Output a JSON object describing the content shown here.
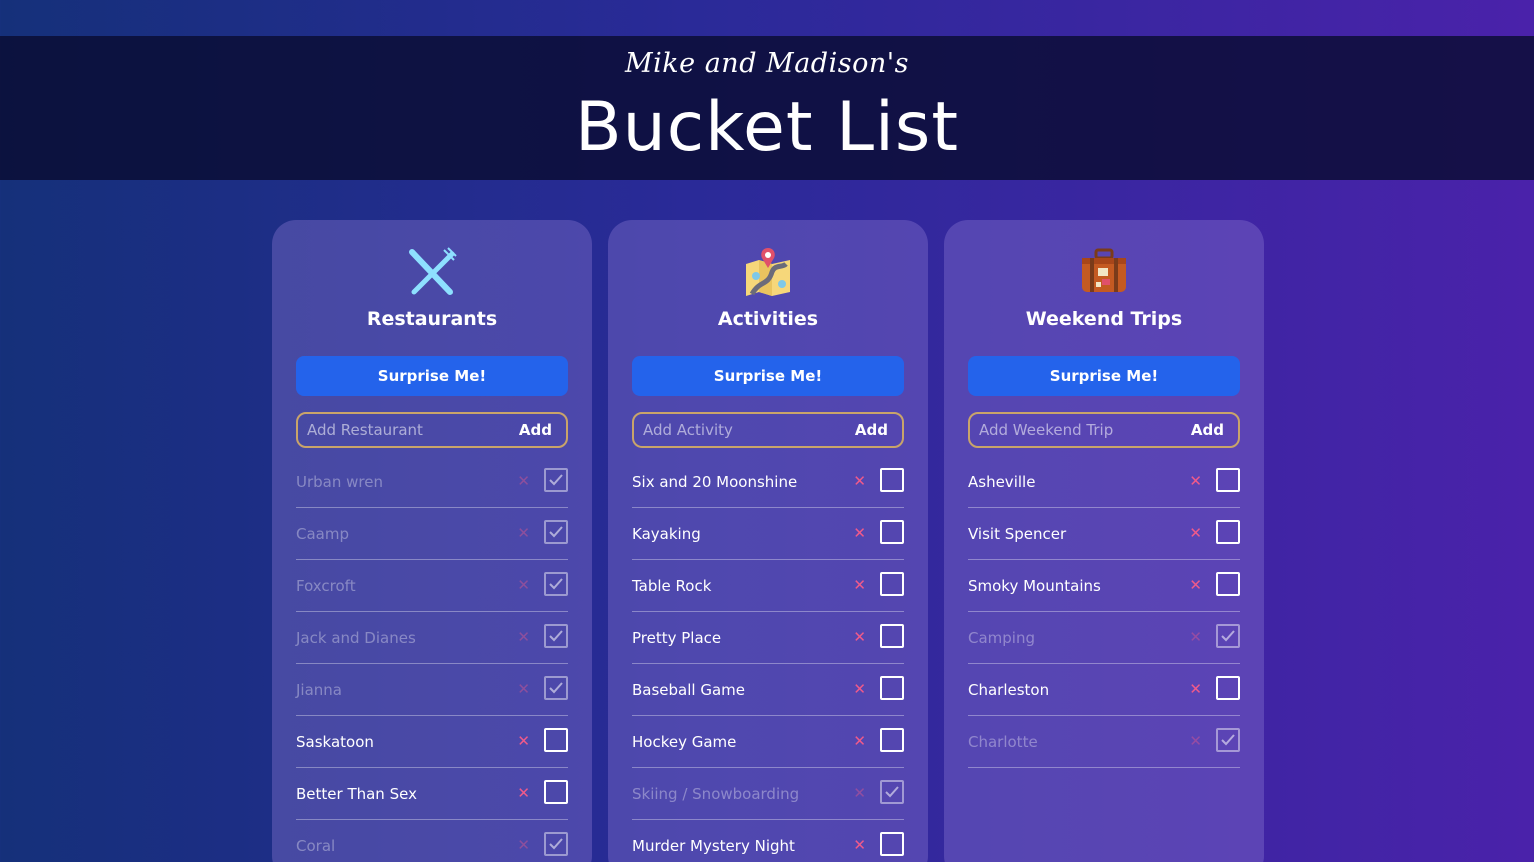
{
  "header": {
    "script_title": "Mike and Madison's",
    "title": "Bucket List"
  },
  "colors": {
    "accent": "#2463eb",
    "input_border": "#c9a46a",
    "delete": "#f05a8a"
  },
  "restaurants": {
    "icon": "fork-knife-icon",
    "title": "Restaurants",
    "surprise_label": "Surprise Me!",
    "add_placeholder": "Add Restaurant",
    "add_label": "Add",
    "items": [
      {
        "label": "Urban wren",
        "done": true
      },
      {
        "label": "Caamp",
        "done": true
      },
      {
        "label": "Foxcroft",
        "done": true
      },
      {
        "label": "Jack and Dianes",
        "done": true
      },
      {
        "label": "Jianna",
        "done": true
      },
      {
        "label": "Saskatoon",
        "done": false
      },
      {
        "label": "Better Than Sex",
        "done": false
      },
      {
        "label": "Coral",
        "done": true
      }
    ]
  },
  "activities": {
    "icon": "map-pin-icon",
    "title": "Activities",
    "surprise_label": "Surprise Me!",
    "add_placeholder": "Add Activity",
    "add_label": "Add",
    "items": [
      {
        "label": "Six and 20 Moonshine",
        "done": false
      },
      {
        "label": "Kayaking",
        "done": false
      },
      {
        "label": "Table Rock",
        "done": false
      },
      {
        "label": "Pretty Place",
        "done": false
      },
      {
        "label": "Baseball Game",
        "done": false
      },
      {
        "label": "Hockey Game",
        "done": false
      },
      {
        "label": "Skiing / Snowboarding",
        "done": true
      },
      {
        "label": "Murder Mystery Night",
        "done": false
      }
    ]
  },
  "weekend": {
    "icon": "suitcase-icon",
    "title": "Weekend Trips",
    "surprise_label": "Surprise Me!",
    "add_placeholder": "Add Weekend Trip",
    "add_label": "Add",
    "items": [
      {
        "label": "Asheville",
        "done": false
      },
      {
        "label": "Visit Spencer",
        "done": false
      },
      {
        "label": "Smoky Mountains",
        "done": false
      },
      {
        "label": "Camping",
        "done": true
      },
      {
        "label": "Charleston",
        "done": false
      },
      {
        "label": "Charlotte",
        "done": true
      }
    ]
  }
}
